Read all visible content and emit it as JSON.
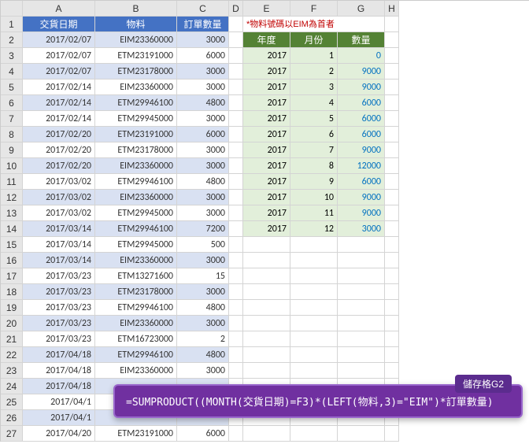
{
  "columns": [
    "A",
    "B",
    "C",
    "D",
    "E",
    "F",
    "G",
    "H"
  ],
  "rows": 27,
  "tableA": {
    "headers": [
      "交貨日期",
      "物料",
      "訂單數量"
    ],
    "data": [
      [
        "2017/02/07",
        "EIM23360000",
        "3000"
      ],
      [
        "2017/02/07",
        "ETM23191000",
        "6000"
      ],
      [
        "2017/02/07",
        "ETM23178000",
        "3000"
      ],
      [
        "2017/02/14",
        "EIM23360000",
        "3000"
      ],
      [
        "2017/02/14",
        "ETM29946100",
        "4800"
      ],
      [
        "2017/02/14",
        "ETM29945000",
        "3000"
      ],
      [
        "2017/02/20",
        "ETM23191000",
        "6000"
      ],
      [
        "2017/02/20",
        "ETM23178000",
        "3000"
      ],
      [
        "2017/02/20",
        "EIM23360000",
        "3000"
      ],
      [
        "2017/03/02",
        "ETM29946100",
        "4800"
      ],
      [
        "2017/03/02",
        "EIM23360000",
        "3000"
      ],
      [
        "2017/03/02",
        "ETM29945000",
        "3000"
      ],
      [
        "2017/03/14",
        "ETM29946100",
        "7200"
      ],
      [
        "2017/03/14",
        "ETM29945000",
        "500"
      ],
      [
        "2017/03/14",
        "EIM23360000",
        "3000"
      ],
      [
        "2017/03/23",
        "ETM13271600",
        "15"
      ],
      [
        "2017/03/23",
        "ETM23178000",
        "3000"
      ],
      [
        "2017/03/23",
        "ETM29946100",
        "4800"
      ],
      [
        "2017/03/23",
        "EIM23360000",
        "3000"
      ],
      [
        "2017/03/23",
        "ETM16723000",
        "2"
      ],
      [
        "2017/04/18",
        "ETM29946100",
        "4800"
      ],
      [
        "2017/04/18",
        "EIM23360000",
        "3000"
      ],
      [
        "2017/04/18",
        "",
        "",
        ""
      ],
      [
        "2017/04/1",
        "",
        ""
      ],
      [
        "2017/04/1",
        "",
        ""
      ],
      [
        "2017/04/20",
        "ETM23191000",
        "6000"
      ]
    ]
  },
  "note": "*物料號碼以EIM為首者",
  "tableB": {
    "headers": [
      "年度",
      "月份",
      "數量"
    ],
    "data": [
      [
        "2017",
        "1",
        "0"
      ],
      [
        "2017",
        "2",
        "9000"
      ],
      [
        "2017",
        "3",
        "9000"
      ],
      [
        "2017",
        "4",
        "6000"
      ],
      [
        "2017",
        "5",
        "6000"
      ],
      [
        "2017",
        "6",
        "6000"
      ],
      [
        "2017",
        "7",
        "9000"
      ],
      [
        "2017",
        "8",
        "12000"
      ],
      [
        "2017",
        "9",
        "6000"
      ],
      [
        "2017",
        "10",
        "9000"
      ],
      [
        "2017",
        "11",
        "9000"
      ],
      [
        "2017",
        "12",
        "3000"
      ]
    ]
  },
  "callout": {
    "tag": "儲存格G2",
    "formula": "=SUMPRODUCT((MONTH(交貨日期)=F3)*(LEFT(物料,3)=\"EIM\")*訂單數量)"
  },
  "chart_data": {
    "type": "table",
    "title": "物料號碼以EIM為首者 每月訂單數量",
    "categories": [
      "1",
      "2",
      "3",
      "4",
      "5",
      "6",
      "7",
      "8",
      "9",
      "10",
      "11",
      "12"
    ],
    "series": [
      {
        "name": "數量",
        "values": [
          0,
          9000,
          9000,
          6000,
          6000,
          6000,
          9000,
          12000,
          6000,
          9000,
          9000,
          3000
        ]
      }
    ],
    "year": 2017
  }
}
